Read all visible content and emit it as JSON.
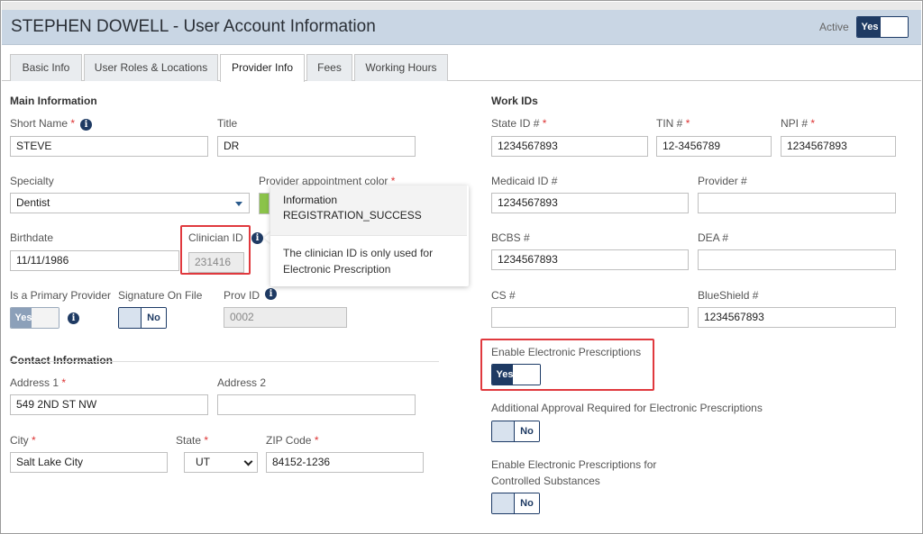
{
  "header": {
    "title": "STEPHEN DOWELL - User Account Information",
    "active_label": "Active",
    "active_toggle": "Yes"
  },
  "tabs": [
    {
      "label": "Basic Info"
    },
    {
      "label": "User Roles & Locations"
    },
    {
      "label": "Provider Info",
      "active": true
    },
    {
      "label": "Fees"
    },
    {
      "label": "Working Hours"
    }
  ],
  "main_info": {
    "section_title": "Main Information",
    "short_name_label": "Short Name",
    "short_name_value": "STEVE",
    "title_label": "Title",
    "title_value": "DR",
    "specialty_label": "Specialty",
    "specialty_value": "Dentist",
    "appt_color_label": "Provider appointment color",
    "birthdate_label": "Birthdate",
    "birthdate_value": "11/11/1986",
    "clinician_id_label": "Clinician ID",
    "clinician_id_value": "231416",
    "primary_provider_label": "Is a Primary Provider",
    "primary_provider_toggle": "Yes",
    "signature_label": "Signature On File",
    "signature_toggle": "No",
    "prov_id_label": "Prov ID",
    "prov_id_value": "0002"
  },
  "contact_info": {
    "section_title": "Contact Information",
    "address1_label": "Address 1",
    "address1_value": "549 2ND ST NW",
    "address2_label": "Address 2",
    "address2_value": "",
    "city_label": "City",
    "city_value": "Salt Lake City",
    "state_label": "State",
    "state_value": "UT",
    "zip_label": "ZIP Code",
    "zip_value": "84152-1236"
  },
  "work_ids": {
    "section_title": "Work IDs",
    "state_id_label": "State ID #",
    "state_id_value": "1234567893",
    "tin_label": "TIN #",
    "tin_value": "12-3456789",
    "npi_label": "NPI #",
    "npi_value": "1234567893",
    "medicaid_label": "Medicaid ID #",
    "medicaid_value": "1234567893",
    "provider_num_label": "Provider #",
    "provider_num_value": "",
    "bcbs_label": "BCBS #",
    "bcbs_value": "1234567893",
    "dea_label": "DEA #",
    "dea_value": "",
    "cs_label": "CS #",
    "cs_value": "",
    "blueshield_label": "BlueShield #",
    "blueshield_value": "1234567893",
    "eprescribe_label": "Enable Electronic Prescriptions",
    "eprescribe_toggle": "Yes",
    "approval_label": "Additional Approval Required for Electronic Prescriptions",
    "approval_toggle": "No",
    "controlled_label_line1": "Enable Electronic Prescriptions for",
    "controlled_label_line2": "Controlled Substances",
    "controlled_toggle": "No"
  },
  "tooltip": {
    "title": "Information",
    "subtitle": "REGISTRATION_SUCCESS",
    "body": "The clinician ID is only used for Electronic Prescription"
  },
  "colors": {
    "header_bg": "#c9d6e4",
    "toggle_navy": "#1e3a63",
    "required_red": "#dd3333",
    "highlight_red": "#e0393e",
    "appt_color_swatch": "#8bc34a"
  }
}
